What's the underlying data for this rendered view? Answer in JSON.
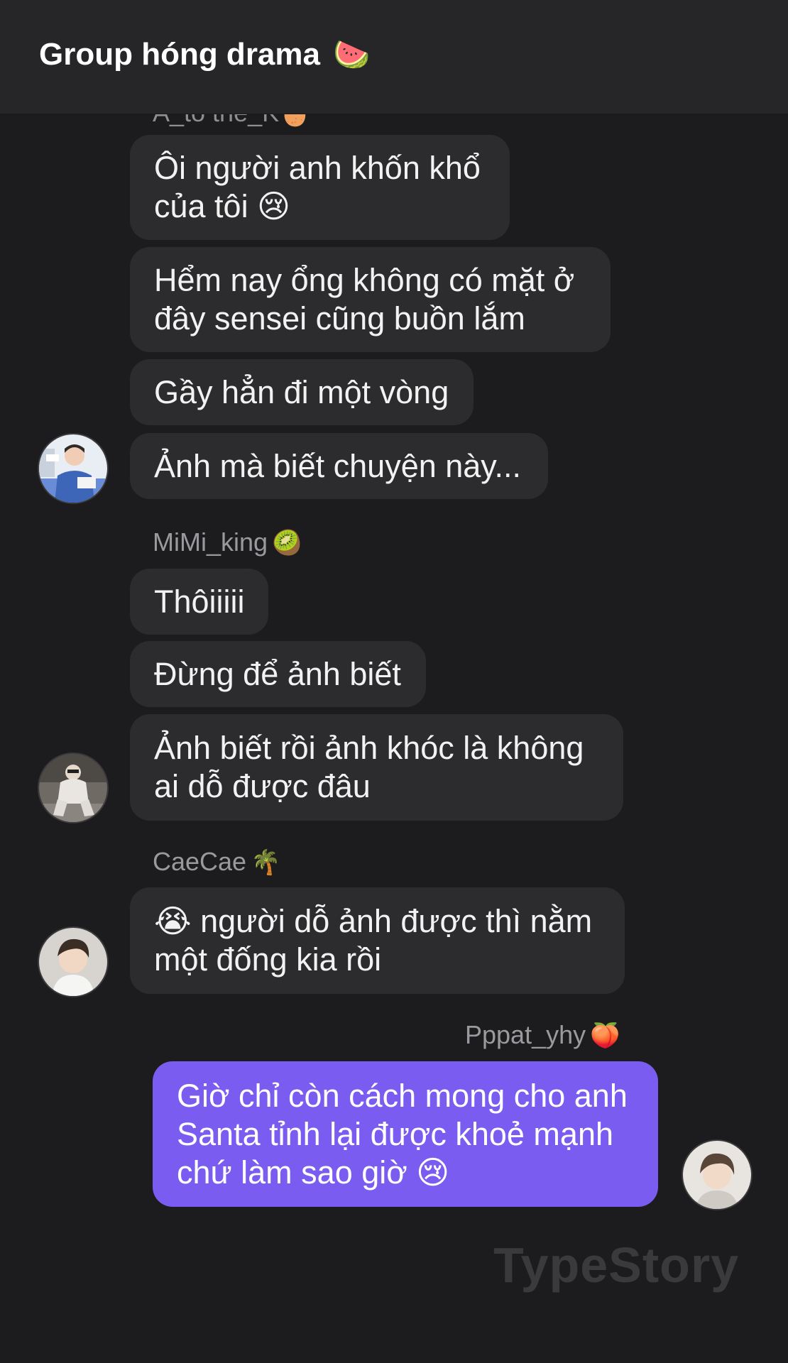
{
  "header": {
    "title": "Group hóng drama",
    "emoji": "🍉"
  },
  "messages": [
    {
      "sender": "A_to the_K",
      "sender_emoji": "🥚",
      "bubbles": [
        "Ôi người anh khốn khổ\ncủa tôi 😢",
        "Hểm nay ổng không có mặt ở\nđây sensei cũng buồn lắm",
        "Gầy hẳn đi một vòng",
        "Ảnh mà biết chuyện này..."
      ]
    },
    {
      "sender": "MiMi_king",
      "sender_emoji": "🥝",
      "bubbles": [
        "Thôiiiii",
        "Đừng để ảnh biết",
        "Ảnh biết rồi ảnh khóc là không\nai dỗ được đâu"
      ]
    },
    {
      "sender": "CaeCae",
      "sender_emoji": "🌴",
      "bubbles": [
        "😭 người dỗ ảnh được thì nằm\nmột đống kia rồi"
      ]
    },
    {
      "sender": "Pppat_yhy",
      "sender_emoji": "🍑",
      "bubbles": [
        "Giờ chỉ còn cách mong cho anh\nSanta tỉnh lại được khoẻ mạnh\nchứ làm sao giờ 😢"
      ]
    }
  ],
  "watermark": "TypeStory"
}
